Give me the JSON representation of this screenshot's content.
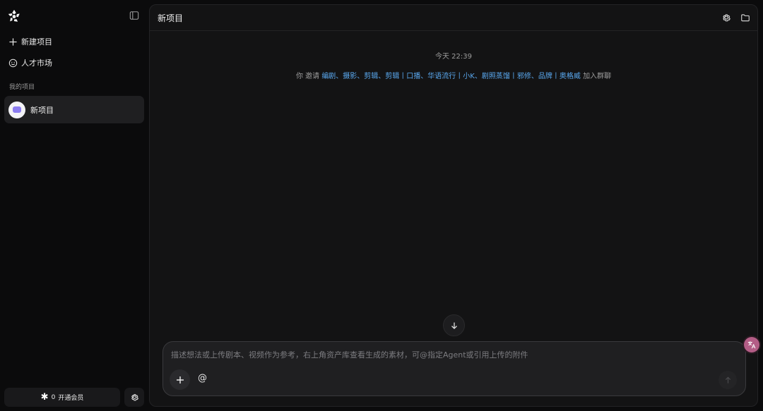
{
  "sidebar": {
    "new_project_label": "新建项目",
    "talent_market_label": "人才市场",
    "section_label": "我的项目",
    "projects": [
      {
        "name": "新项目"
      }
    ],
    "member_count": "0",
    "member_label": "开通会员"
  },
  "main": {
    "title": "新项目",
    "timestamp": "今天 22:39",
    "invite": {
      "inviter": "你",
      "verb": "邀请",
      "names": "编剧、摄影、剪辑、剪辑丨口播、华语流行丨小K、剧照蒸馏丨邪修、品牌丨奥格威",
      "suffix": "加入群聊"
    }
  },
  "composer": {
    "placeholder": "描述想法或上传剧本、视频作为参考，右上角资产库查看生成的素材，可@指定Agent或引用上传的附件",
    "value": "",
    "at_symbol": "@"
  },
  "colors": {
    "background": "#0b0b0c",
    "panel": "#131314",
    "link": "#5aa9f0",
    "selected_item": "#1f1f21",
    "fab": "#b35d86"
  }
}
